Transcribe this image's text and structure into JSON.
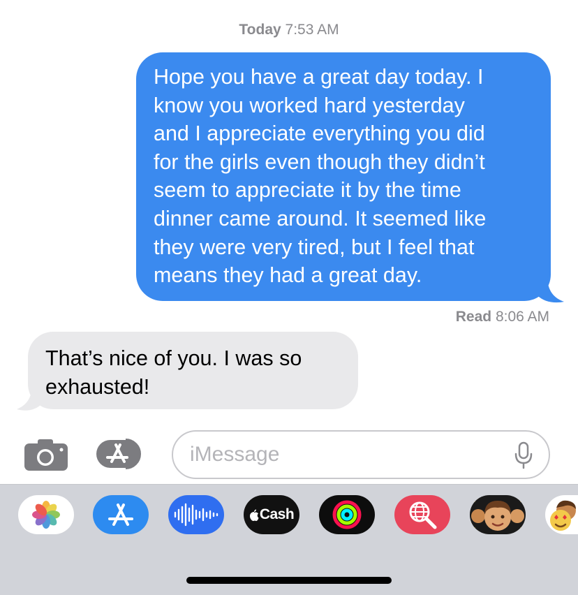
{
  "header": {
    "timestamp_day": "Today",
    "timestamp_time": "7:53 AM"
  },
  "messages": {
    "outgoing": [
      "Hope you have a great day today. I",
      "know you worked hard yesterday",
      "and I appreciate everything you did",
      "for the girls even though they didn’t",
      "seem to appreciate it by the time",
      "dinner came around. It seemed like",
      "they were very tired, but I feel that",
      "means they had a great day."
    ],
    "read_receipt": {
      "label": "Read",
      "time": "8:06 AM"
    },
    "incoming": [
      "That’s nice of you.  I was so",
      "exhausted!"
    ]
  },
  "composer": {
    "placeholder": "iMessage",
    "value": "",
    "camera_icon": "camera-icon",
    "apps_icon": "app-store-icon",
    "mic_icon": "microphone-icon"
  },
  "app_drawer": {
    "apps": [
      {
        "name": "photos",
        "icon": "photos-icon"
      },
      {
        "name": "app-store",
        "icon": "app-store-icon"
      },
      {
        "name": "audio-message",
        "icon": "waveform-icon"
      },
      {
        "name": "apple-cash",
        "icon": "cash-icon",
        "label": "Cash"
      },
      {
        "name": "fitness",
        "icon": "activity-rings-icon"
      },
      {
        "name": "images-search",
        "icon": "globe-search-icon"
      },
      {
        "name": "memoji",
        "icon": "memoji-icon"
      },
      {
        "name": "memoji-stickers",
        "icon": "memoji-stickers-icon"
      }
    ]
  },
  "colors": {
    "outgoing_bubble": "#3b8aef",
    "incoming_bubble": "#e9e9eb",
    "timestamp_gray": "#8a8a8e",
    "drawer_background": "#d1d3d9"
  }
}
